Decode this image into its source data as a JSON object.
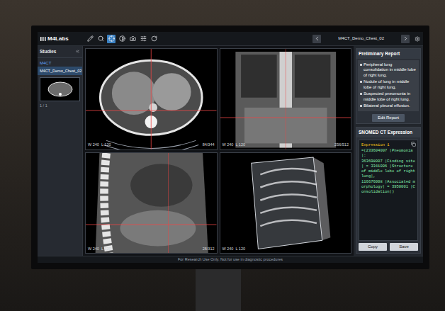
{
  "toolbar": {
    "logo": "M4Labs",
    "tools": [
      {
        "selected": false
      },
      {
        "selected": false
      },
      {
        "selected": true
      },
      {
        "selected": false
      },
      {
        "selected": false
      },
      {
        "selected": false
      },
      {
        "selected": false
      }
    ],
    "study_title": "M4CT_Demo_Chest_02"
  },
  "sidebar": {
    "title": "Studies",
    "group": "M4CT",
    "studies": [
      {
        "name": "M4CT_Demo_Chest_02",
        "selected": true,
        "counter": "1 / 1"
      }
    ]
  },
  "viewports": [
    {
      "kind": "axial",
      "window": "W 240  L 120",
      "slice": "84/344"
    },
    {
      "kind": "coronal",
      "window": "W 240  L 120",
      "slice": "256/512"
    },
    {
      "kind": "sagittal",
      "window": "W 240  L 120",
      "slice": "28/312"
    },
    {
      "kind": "volume",
      "window": "W 240  L 120",
      "slice": ""
    }
  ],
  "report": {
    "title": "Preliminary Report",
    "findings": [
      "Peripheral lung consolidation in middle lobe of right lung.",
      "Nodule of lung in middle lobe of right lung.",
      "Suspected pneumonia in middle lobe of right lung.",
      "Bilateral pleural effusion."
    ],
    "edit_button": "Edit Report"
  },
  "snomed": {
    "title": "SNOMED CT Expression",
    "lines": [
      "Expression 1",
      "=(233604007 |Pneumonia|:",
      "363698007 |Finding site| = 3341006 |Structure of middle lobe of right lung|,",
      "116676008 |Associated morphology| = 3950001 |Consolidation|)"
    ],
    "buttons": [
      "Copy",
      "Save"
    ]
  },
  "footer": "For Research Use Only. Not for use in diagnostic procedures"
}
